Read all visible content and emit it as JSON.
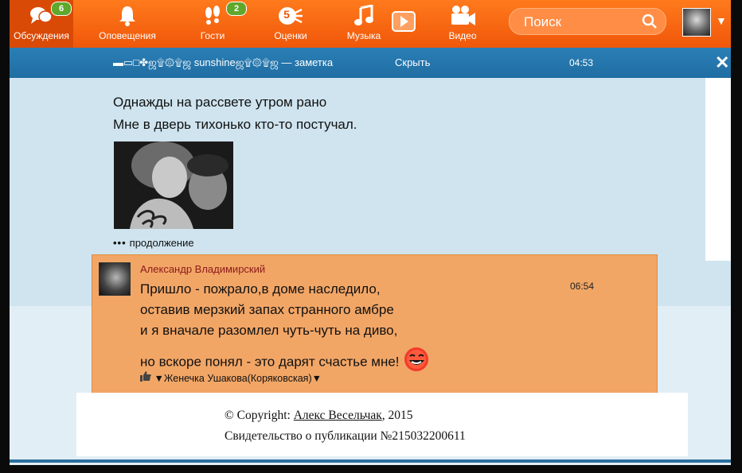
{
  "nav": {
    "items": [
      {
        "label": "Обсуждения",
        "badge": "6"
      },
      {
        "label": "Оповещения",
        "badge": ""
      },
      {
        "label": "Гости",
        "badge": "2"
      },
      {
        "label": "Оценки",
        "badge": "5"
      },
      {
        "label": "Музыка",
        "badge": ""
      },
      {
        "label": "Видео",
        "badge": ""
      }
    ],
    "search_placeholder": "Поиск"
  },
  "note_bar": {
    "author": "▬▭□✤ஜ۩۞۩ஜ sunshineஜ۩۞۩ஜ — заметка",
    "hide_label": "Скрыть",
    "time": "04:53",
    "close": "✕"
  },
  "post": {
    "lines": [
      "Однажды на рассвете утром рано",
      "Мне в дверь тихонько кто-то постучал."
    ],
    "more_dots": "•••",
    "more_label": "продолжение"
  },
  "comment": {
    "author": "Александр Владимирский",
    "time": "06:54",
    "lines": [
      "Пришло - пожрало,в доме наследило,",
      "оставив мерзкий запах странного амбре",
      "и я вначале разомлел чуть-чуть на диво,",
      "но вскоре понял - это дарят счастье мне!"
    ],
    "like_user": "▼Женечка Ушакова(Коряковская)▼"
  },
  "footer": {
    "copyright_prefix": "© Copyright: ",
    "copyright_author": "Алекс Весельчак",
    "copyright_year": ", 2015",
    "certificate": "Свидетельство о публикации №215032200611"
  },
  "colors": {
    "nav_orange": "#f0570a",
    "note_bar_blue": "#1f6ea3",
    "comment_bg": "#f2a666",
    "author_red": "#8b1a1a"
  }
}
